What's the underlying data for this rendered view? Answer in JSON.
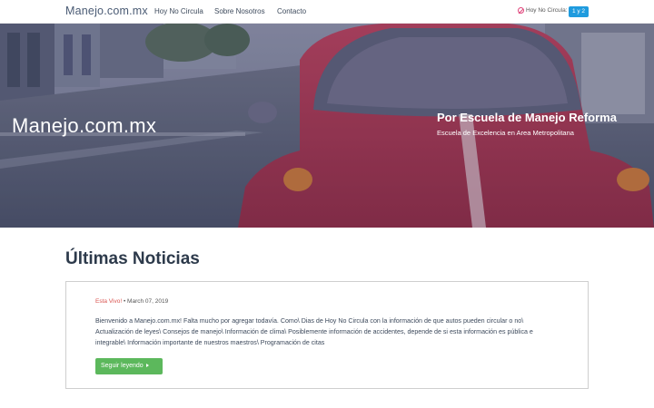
{
  "navbar": {
    "brand": "Manejo.com.mx",
    "links": [
      "Hoy No Circula",
      "Sobre Nosotros",
      "Contacto"
    ],
    "status_label": "Hoy No Circula:",
    "status_badge": "1 y 2"
  },
  "hero": {
    "title": "Manejo.com.mx",
    "subtitle": "Por Escuela de Manejo Reforma",
    "tagline": "Escuela de Excelencia en Area Metropolitana"
  },
  "news": {
    "heading": "Últimas Noticias",
    "post": {
      "author": "Esta Vivo!",
      "date_sep": " • ",
      "date": "March 07, 2019",
      "excerpt": "Bienvenido a Manejo.com.mx! Falta mucho por agregar todavía. Como\\ Dias de Hoy No Circula con la información de que autos pueden circular o no\\ Actualización de leyes\\ Consejos de manejo\\ Información de clima\\ Posiblemente información de accidentes, depende de si esta información es pública e integrable\\ Información importante de nuestros maestros\\ Programación de citas",
      "read_more": "Seguir leyendo"
    }
  },
  "colors": {
    "brand_text": "#4a5b74",
    "badge": "#1f9bde",
    "hero_overlay": "#2c3550",
    "car_red": "#c8304e",
    "author": "#d9534f",
    "button": "#5cb85c"
  },
  "icons": [
    "ban-icon",
    "caret-right-icon"
  ]
}
